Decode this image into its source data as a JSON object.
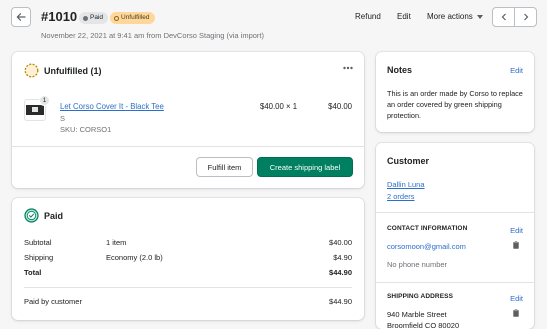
{
  "header": {
    "order_number": "#1010",
    "badge_paid": "Paid",
    "badge_unfulfilled": "Unfulfilled",
    "subtitle": "November 22, 2021 at 9:41 am from DevCorso Staging (via import)",
    "refund_label": "Refund",
    "edit_label": "Edit",
    "more_actions_label": "More actions"
  },
  "unfulfilled_card": {
    "title": "Unfulfilled (1)",
    "item": {
      "quantity_badge": "1",
      "name": "Let Corso Cover It - Black Tee",
      "variant": "S",
      "sku": "SKU: CORSO1",
      "unit_price": "$40.00 × 1",
      "total": "$40.00"
    },
    "fulfill_button": "Fulfill item",
    "shipping_label_button": "Create shipping label"
  },
  "paid_card": {
    "title": "Paid",
    "rows": [
      {
        "label": "Subtotal",
        "detail": "1 item",
        "amount": "$40.00"
      },
      {
        "label": "Shipping",
        "detail": "Economy (2.0 lb)",
        "amount": "$4.90"
      },
      {
        "label": "Total",
        "detail": "",
        "amount": "$44.90"
      }
    ],
    "paid_by_label": "Paid by customer",
    "paid_by_amount": "$44.90"
  },
  "notes_card": {
    "title": "Notes",
    "edit_label": "Edit",
    "text": "This is an order made by Corso to replace an order covered by green shipping protection."
  },
  "customer_card": {
    "title": "Customer",
    "name": "Dallin Luna",
    "orders": "2 orders",
    "contact_label": "CONTACT INFORMATION",
    "contact_edit": "Edit",
    "email": "corsomoon@gmail.com",
    "phone": "No phone number",
    "shipping_label": "SHIPPING ADDRESS",
    "shipping_edit": "Edit",
    "address_line1": "940 Marble Street",
    "address_line2": "Broomfield CO 80020"
  },
  "colors": {
    "primary_button": "#008060",
    "link": "#2c6ecb",
    "badge_unfulfilled_bg": "#ffd79d",
    "badge_paid_bg": "#e4e5e7"
  },
  "icons": {
    "back": "arrow-left-icon",
    "unfulfilled": "unfulfilled-circle-icon",
    "paid": "paid-check-circle-icon",
    "more": "horizontal-dots-icon",
    "copy": "clipboard-icon"
  }
}
